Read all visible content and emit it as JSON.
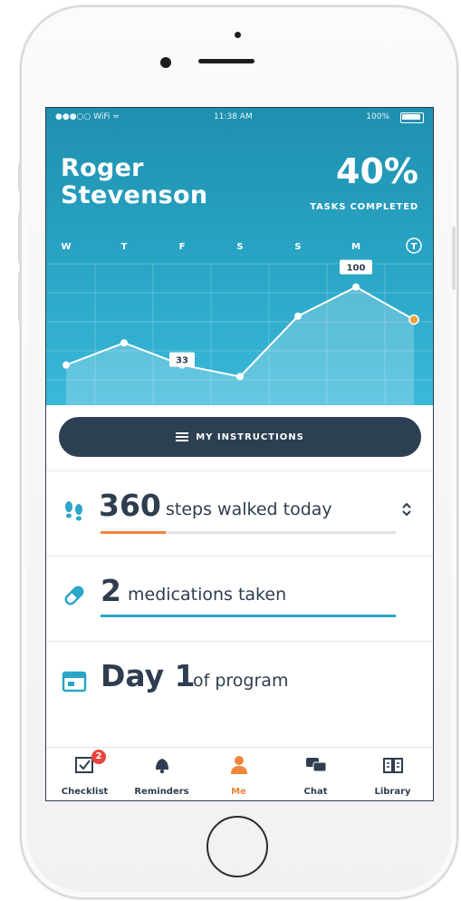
{
  "status_bar": {
    "signal": "●●●○○ WiFi ≈",
    "time": "11:38 AM",
    "battery": "100%"
  },
  "profile": {
    "first_name": "Roger",
    "last_name": "Stevenson"
  },
  "tasks": {
    "percent": "40%",
    "label": "TASKS COMPLETED"
  },
  "chart_data": {
    "type": "area",
    "categories": [
      "W",
      "T",
      "F",
      "S",
      "S",
      "M",
      "T"
    ],
    "values": [
      33,
      52,
      33,
      23,
      75,
      100,
      72
    ],
    "data_labels": {
      "2": "33",
      "5": "100"
    },
    "ylim": [
      0,
      120
    ],
    "grid": true,
    "highlight_last_point": true,
    "colors": {
      "line": "#ffffff",
      "fill": "#ffffff",
      "last_point": "#f0a23a"
    }
  },
  "instructions_button": {
    "icon": "list-icon",
    "label": "MY INSTRUCTIONS"
  },
  "metrics": [
    {
      "icon": "footsteps-icon",
      "value": "360",
      "text": "steps walked today",
      "progress": 0.22,
      "color": "#f0863a"
    },
    {
      "icon": "pill-icon",
      "value": "2",
      "text": "medications taken",
      "progress": 1.0,
      "color": "#2aa6c6"
    },
    {
      "icon": "calendar-icon",
      "value": "Day 1",
      "text": "of program"
    }
  ],
  "tabs": [
    {
      "label": "Checklist",
      "icon": "checklist-icon",
      "badge": "2",
      "active": false
    },
    {
      "label": "Reminders",
      "icon": "bell-icon",
      "active": false
    },
    {
      "label": "Me",
      "icon": "person-icon",
      "active": true
    },
    {
      "label": "Chat",
      "icon": "chat-icon",
      "active": false
    },
    {
      "label": "Library",
      "icon": "book-icon",
      "active": false
    }
  ],
  "colors": {
    "accent": "#f0863a",
    "dark": "#2d3f52",
    "teal": "#2aa6c6"
  }
}
